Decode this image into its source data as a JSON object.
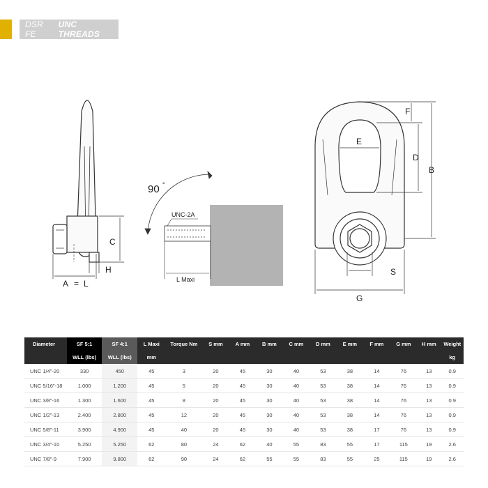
{
  "header": {
    "title_part1": "DSR FE",
    "title_part2": "UNC THREADS"
  },
  "drawing": {
    "angle_label": "90",
    "thread_label": "UNC-2A",
    "l_maxi_label": "L Maxi",
    "side_view": {
      "a_label": "A",
      "eq_label": "=",
      "l_label": "L",
      "c_label": "C",
      "h_label": "H"
    },
    "front_view": {
      "e_label": "E",
      "f_label": "F",
      "d_label": "D",
      "b_label": "B",
      "s_label": "S",
      "g_label": "G"
    }
  },
  "table": {
    "headers_row1": [
      "Diameter",
      "SF 5:1",
      "SF 4:1",
      "L Maxi",
      "Torque Nm",
      "S mm",
      "A mm",
      "B mm",
      "C mm",
      "D mm",
      "E mm",
      "F mm",
      "G mm",
      "H mm",
      "Weight"
    ],
    "headers_row2": [
      "",
      "WLL (lbs)",
      "WLL (lbs)",
      "mm",
      "",
      "",
      "",
      "",
      "",
      "",
      "",
      "",
      "",
      "",
      "kg"
    ],
    "rows": [
      [
        "UNC 1/4\"-20",
        "330",
        "450",
        "45",
        "3",
        "20",
        "45",
        "30",
        "40",
        "53",
        "38",
        "14",
        "76",
        "13",
        "0.9"
      ],
      [
        "UNC 5/16\"-18",
        "1.000",
        "1.200",
        "45",
        "5",
        "20",
        "45",
        "30",
        "40",
        "53",
        "38",
        "14",
        "76",
        "13",
        "0.9"
      ],
      [
        "UNC 3/8\"-16",
        "1.300",
        "1.600",
        "45",
        "8",
        "20",
        "45",
        "30",
        "40",
        "53",
        "38",
        "14",
        "76",
        "13",
        "0.9"
      ],
      [
        "UNC 1/2\"-13",
        "2.400",
        "2.800",
        "45",
        "12",
        "20",
        "45",
        "30",
        "40",
        "53",
        "38",
        "14",
        "76",
        "13",
        "0.9"
      ],
      [
        "UNC 5/8\"-11",
        "3.900",
        "4.900",
        "45",
        "40",
        "20",
        "45",
        "30",
        "40",
        "53",
        "38",
        "17",
        "76",
        "13",
        "0.9"
      ],
      [
        "UNC 3/4\"-10",
        "5.250",
        "5.250",
        "62",
        "80",
        "24",
        "62",
        "40",
        "55",
        "83",
        "55",
        "17",
        "115",
        "19",
        "2.6"
      ],
      [
        "UNC 7/8\"-9",
        "7.900",
        "9.800",
        "62",
        "90",
        "24",
        "62",
        "55",
        "55",
        "83",
        "55",
        "25",
        "115",
        "19",
        "2.6"
      ]
    ]
  }
}
